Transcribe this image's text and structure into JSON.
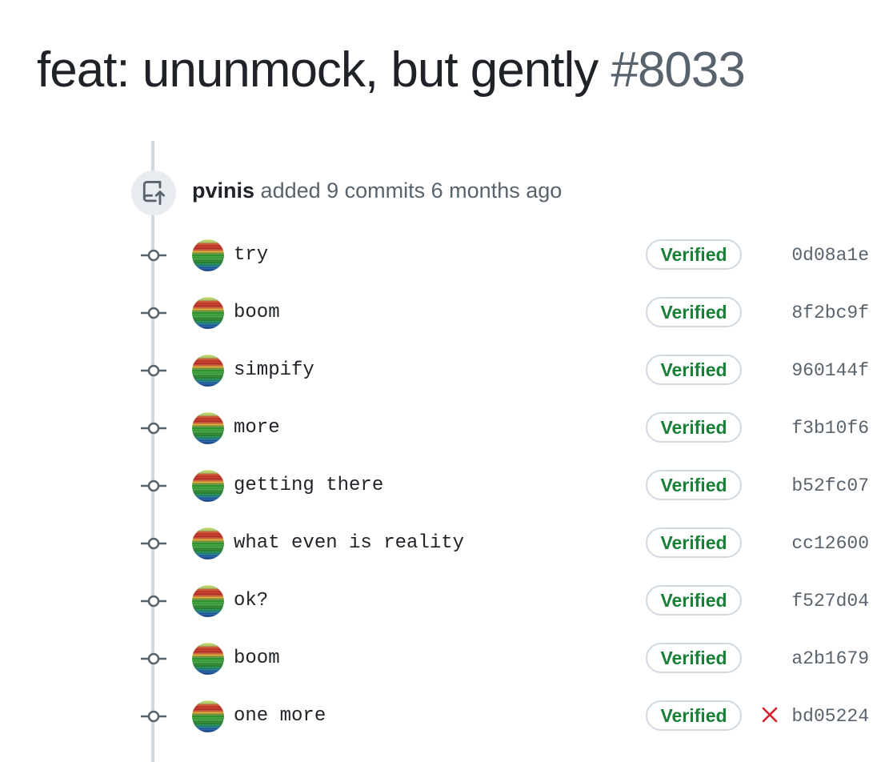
{
  "pr": {
    "title": "feat: ununmock, but gently",
    "number": "#8033"
  },
  "event": {
    "icon": "push-icon",
    "author": "pvinis",
    "action_text": "added 9 commits 6 months ago"
  },
  "commits": [
    {
      "message": "try",
      "verified_label": "Verified",
      "sha": "0d08a1e",
      "status": null
    },
    {
      "message": "boom",
      "verified_label": "Verified",
      "sha": "8f2bc9f",
      "status": null
    },
    {
      "message": "simpify",
      "verified_label": "Verified",
      "sha": "960144f",
      "status": null
    },
    {
      "message": "more",
      "verified_label": "Verified",
      "sha": "f3b10f6",
      "status": null
    },
    {
      "message": "getting there",
      "verified_label": "Verified",
      "sha": "b52fc07",
      "status": null
    },
    {
      "message": "what even is reality",
      "verified_label": "Verified",
      "sha": "cc12600",
      "status": null
    },
    {
      "message": "ok?",
      "verified_label": "Verified",
      "sha": "f527d04",
      "status": null
    },
    {
      "message": "boom",
      "verified_label": "Verified",
      "sha": "a2b1679",
      "status": null
    },
    {
      "message": "one more",
      "verified_label": "Verified",
      "sha": "bd05224",
      "status": "failure"
    }
  ],
  "colors": {
    "verified": "#1a7f37",
    "failure": "#cf222e",
    "muted": "#59636e",
    "timeline": "#d1d9e0"
  }
}
